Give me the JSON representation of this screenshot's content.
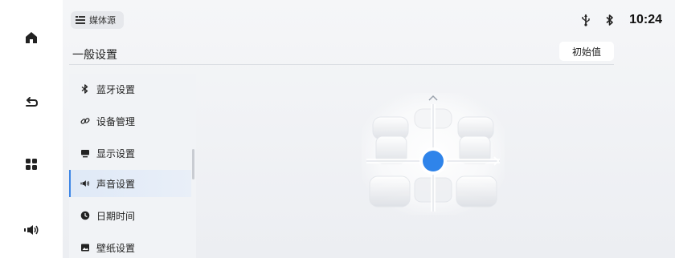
{
  "status": {
    "media_source_label": "媒体源",
    "clock": "10:24"
  },
  "page": {
    "title": "一般设置",
    "reset_label": "初始值"
  },
  "menu": {
    "items": [
      {
        "label": "蓝牙设置",
        "icon": "bluetooth-icon",
        "active": false
      },
      {
        "label": "设备管理",
        "icon": "link-icon",
        "active": false
      },
      {
        "label": "显示设置",
        "icon": "display-icon",
        "active": false
      },
      {
        "label": "声音设置",
        "icon": "speaker-icon",
        "active": true
      },
      {
        "label": "日期时间",
        "icon": "clock-icon",
        "active": false
      },
      {
        "label": "壁纸设置",
        "icon": "image-icon",
        "active": false
      }
    ]
  },
  "rail": {
    "buttons": [
      "home-icon",
      "back-icon",
      "apps-icon",
      "volume-icon"
    ]
  },
  "colors": {
    "accent": "#2f84ea",
    "active_bg": "#e3ecf8"
  }
}
